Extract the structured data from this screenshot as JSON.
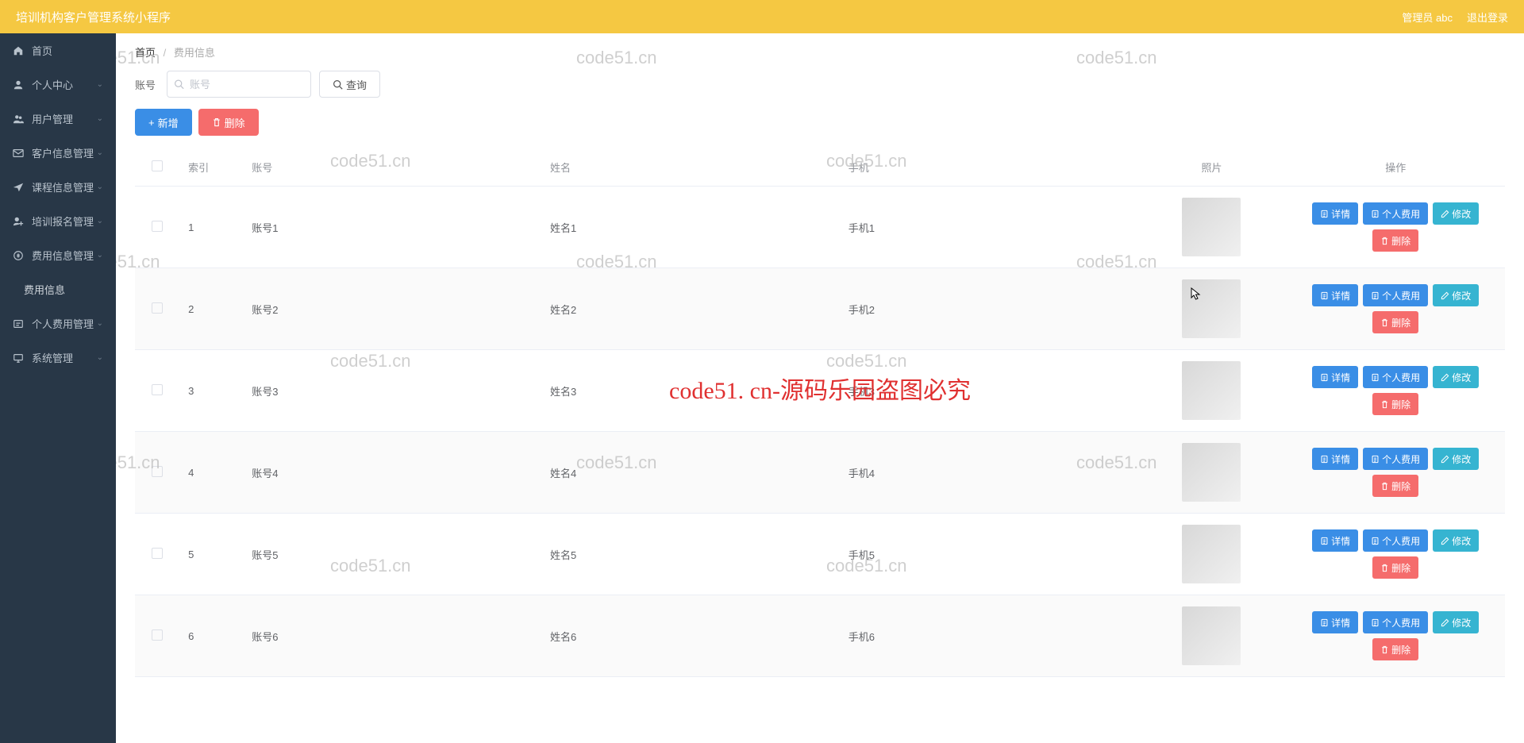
{
  "header": {
    "title": "培训机构客户管理系统小程序",
    "admin_label": "管理员 abc",
    "logout_label": "退出登录"
  },
  "sidebar": {
    "items": [
      {
        "icon": "home",
        "label": "首页",
        "expandable": false
      },
      {
        "icon": "user",
        "label": "个人中心",
        "expandable": true
      },
      {
        "icon": "users",
        "label": "用户管理",
        "expandable": true
      },
      {
        "icon": "mail",
        "label": "客户信息管理",
        "expandable": true
      },
      {
        "icon": "send",
        "label": "课程信息管理",
        "expandable": true
      },
      {
        "icon": "signup",
        "label": "培训报名管理",
        "expandable": true
      },
      {
        "icon": "fee",
        "label": "费用信息管理",
        "expandable": true,
        "open": true,
        "children": [
          {
            "label": "费用信息"
          }
        ]
      },
      {
        "icon": "personal-fee",
        "label": "个人费用管理",
        "expandable": true
      },
      {
        "icon": "system",
        "label": "系统管理",
        "expandable": true
      }
    ]
  },
  "breadcrumb": {
    "home": "首页",
    "current": "费用信息"
  },
  "filter": {
    "label": "账号",
    "placeholder": "账号",
    "query_btn": "查询"
  },
  "actions": {
    "add": "新增",
    "delete": "删除"
  },
  "table": {
    "headers": {
      "index": "索引",
      "account": "账号",
      "name": "姓名",
      "phone": "手机",
      "photo": "照片",
      "operation": "操作"
    },
    "op_buttons": {
      "detail": "详情",
      "personal_fee": "个人费用",
      "edit": "修改",
      "delete": "删除"
    },
    "rows": [
      {
        "index": "1",
        "account": "账号1",
        "name": "姓名1",
        "phone": "手机1"
      },
      {
        "index": "2",
        "account": "账号2",
        "name": "姓名2",
        "phone": "手机2"
      },
      {
        "index": "3",
        "account": "账号3",
        "name": "姓名3",
        "phone": "手机3"
      },
      {
        "index": "4",
        "account": "账号4",
        "name": "姓名4",
        "phone": "手机4"
      },
      {
        "index": "5",
        "account": "账号5",
        "name": "姓名5",
        "phone": "手机5"
      },
      {
        "index": "6",
        "account": "账号6",
        "name": "姓名6",
        "phone": "手机6"
      }
    ]
  },
  "watermarks": {
    "text": "code51.cn",
    "center": "code51. cn-源码乐园盗图必究"
  }
}
